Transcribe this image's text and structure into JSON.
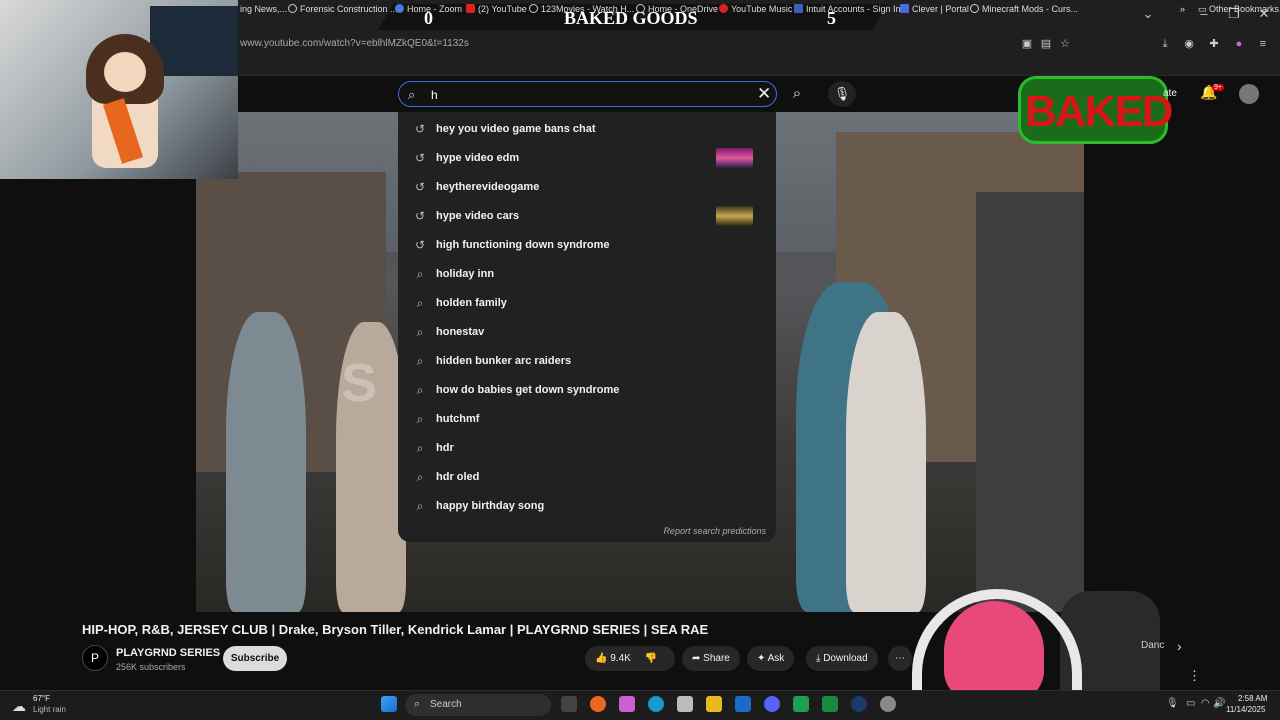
{
  "overlay": {
    "score_left": "0",
    "score_title": "BAKED GOODS",
    "score_right": "5",
    "logo_text": "BAKED"
  },
  "browser": {
    "url": "www.youtube.com/watch?v=eblhlMZkQE0&t=1132s",
    "bookmarks": [
      "ing News,...",
      "Forensic Construction ...",
      "Home - Zoom",
      "(2) YouTube",
      "123Movies - Watch H...",
      "Home - OneDrive",
      "YouTube Music",
      "Intuit Accounts - Sign In",
      "Clever | Portal",
      "Minecraft Mods - Curs..."
    ],
    "other_bookmarks": "Other Bookmarks"
  },
  "search": {
    "query": "h",
    "suggestions": [
      {
        "text": "hey you video game bans chat",
        "icon": "history-icon"
      },
      {
        "text": "hype video edm",
        "icon": "history-icon"
      },
      {
        "text": "heytherevideogame",
        "icon": "history-icon"
      },
      {
        "text": "hype video cars",
        "icon": "history-icon"
      },
      {
        "text": "high functioning down syndrome",
        "icon": "history-icon"
      },
      {
        "text": "holiday inn",
        "icon": "search-icon"
      },
      {
        "text": "holden family",
        "icon": "search-icon"
      },
      {
        "text": "honestav",
        "icon": "search-icon"
      },
      {
        "text": "hidden bunker arc raiders",
        "icon": "search-icon"
      },
      {
        "text": "how do babies get down syndrome",
        "icon": "search-icon"
      },
      {
        "text": "hutchmf",
        "icon": "search-icon"
      },
      {
        "text": "hdr",
        "icon": "search-icon"
      },
      {
        "text": "hdr oled",
        "icon": "search-icon"
      },
      {
        "text": "happy birthday song",
        "icon": "search-icon"
      }
    ],
    "report": "Report search predictions"
  },
  "header": {
    "create_partial": "ate",
    "notifications": "9+"
  },
  "video": {
    "overlay_text": "S          OUR",
    "title": "HIP-HOP, R&B, JERSEY CLUB | Drake, Bryson Tiller, Kendrick Lamar | PLAYGRND SERIES | SEA RAE",
    "channel": "PLAYGRND SERIES",
    "subscribers": "256K subscribers",
    "subscribe": "Subscribe",
    "likes": "9.4K",
    "share": "Share",
    "ask": "Ask",
    "download": "Download",
    "chip": "Danc"
  },
  "taskbar": {
    "temp": "67°F",
    "weather": "Light rain",
    "search": "Search",
    "time": "2:58 AM",
    "date": "11/14/2025"
  },
  "colors": {
    "accent": "#3a6fd8",
    "background": "#0f0f0f",
    "dropdown": "#212121"
  }
}
